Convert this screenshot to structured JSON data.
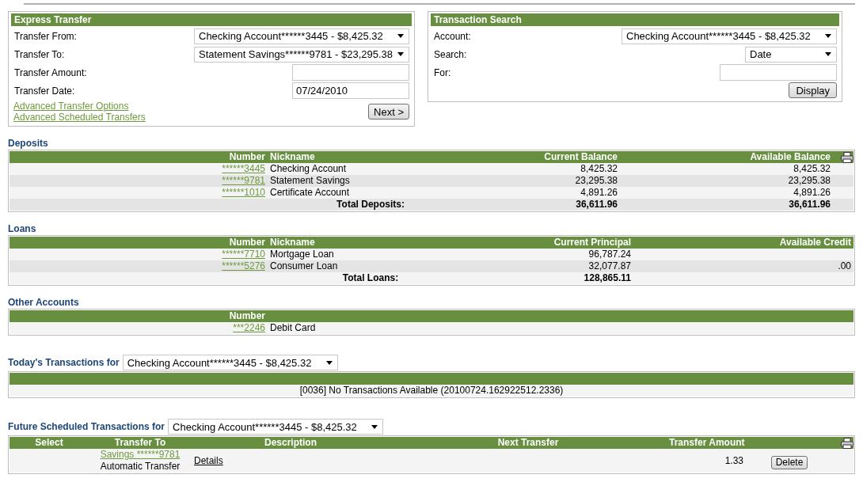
{
  "express_transfer": {
    "title": "Express Transfer",
    "fields": [
      {
        "label": "Transfer From:",
        "kind": "select",
        "value": "Checking Account******3445 - $8,425.32"
      },
      {
        "label": "Transfer To:",
        "kind": "select",
        "value": "Statement Savings******9781 - $23,295.38"
      },
      {
        "label": "Transfer Amount:",
        "kind": "input"
      },
      {
        "label": "Transfer Date:",
        "kind": "input",
        "value": "07/24/2010"
      }
    ],
    "links": [
      "Advanced Transfer Options",
      "Advanced Scheduled Transfers"
    ],
    "button": "Next >"
  },
  "transaction_search": {
    "title": "Transaction Search",
    "fields": [
      {
        "label": "Account:",
        "kind": "select",
        "value": "Checking Account******3445 - $8,425.32"
      },
      {
        "label": "Search:",
        "kind": "short-select",
        "value": "Date"
      },
      {
        "label": "For:",
        "kind": "input"
      }
    ],
    "button": "Display"
  },
  "deposits": {
    "title": "Deposits",
    "columns": [
      "Number",
      "Nickname",
      "Current Balance",
      "Available Balance"
    ],
    "rows": [
      {
        "number": "******3445",
        "nickname": "Checking Account",
        "current": "8,425.32",
        "available": "8,425.32"
      },
      {
        "number": "******9781",
        "nickname": "Statement Savings",
        "current": "23,295.38",
        "available": "23,295.38"
      },
      {
        "number": "******1010",
        "nickname": "Certificate Account",
        "current": "4,891.26",
        "available": "4,891.26"
      }
    ],
    "total": {
      "label": "Total Deposits:",
      "current": "36,611.96",
      "available": "36,611.96"
    }
  },
  "loans": {
    "title": "Loans",
    "columns": [
      "Number",
      "Nickname",
      "Current Principal",
      "Available Credit"
    ],
    "rows": [
      {
        "number": "******7710",
        "nickname": "Mortgage Loan",
        "current": "96,787.24"
      },
      {
        "number": "******5276",
        "nickname": "Consumer Loan",
        "current": "32,077.87",
        "available": ".00"
      }
    ],
    "total": {
      "label": "Total Loans:",
      "current": "128,865.11"
    }
  },
  "other_accounts": {
    "title": "Other Accounts",
    "columns": [
      "Number"
    ],
    "rows": [
      {
        "number": "***2246",
        "nickname": "Debit Card"
      }
    ]
  },
  "todays_transactions": {
    "title": "Today's Transactions for",
    "account": "Checking Account******3445 - $8,425.32",
    "message": "[0036] No Transactions Available (20100724.162922512.2336)"
  },
  "future_scheduled": {
    "title": "Future Scheduled Transactions for",
    "account": "Checking Account******3445 - $8,425.32",
    "columns": [
      "Select",
      "Transfer To",
      "Description",
      "Next Transfer",
      "Transfer Amount"
    ],
    "rows": [
      {
        "transfer_to": "Savings ******9781",
        "type": "Automatic Transfer",
        "description": "Details",
        "amount": "1.33",
        "action": "Delete"
      }
    ]
  }
}
